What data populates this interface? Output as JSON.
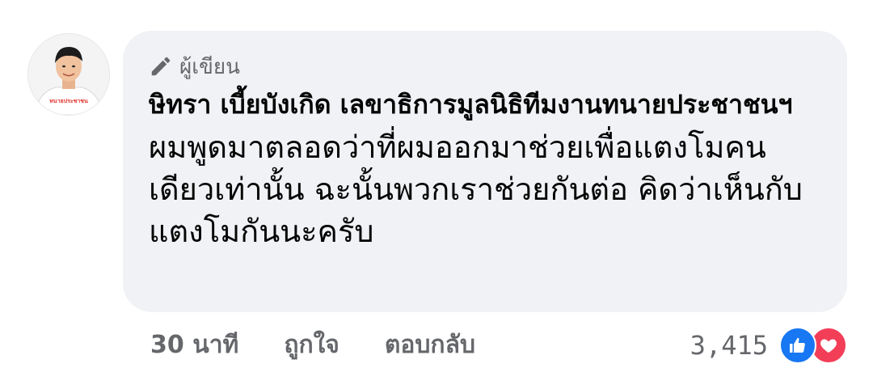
{
  "comment": {
    "badge_label": "ผู้เขียน",
    "badge_icon": "pencil-icon",
    "author": "ษิทรา เบี้ยบังเกิด เลขาธิการมูลนิธิทีมงานทนายประชาชนฯ",
    "text": "ผมพูดมาตลอดว่าที่ผมออกมาช่วยเพื่อแตงโมคนเดียวเท่านั้น ฉะนั้นพวกเราช่วยกันต่อ คิดว่าเห็นกับแตงโมกันนะครับ"
  },
  "actions": {
    "time": "30 นาที",
    "like": "ถูกใจ",
    "reply": "ตอบกลับ"
  },
  "reactions": {
    "count": "3,415",
    "icons": [
      "like-icon",
      "love-icon"
    ],
    "like_color": "#1877f2",
    "love_color": "#f33e58"
  },
  "avatar": {
    "shirt_text": "ทนายประชาชน"
  }
}
